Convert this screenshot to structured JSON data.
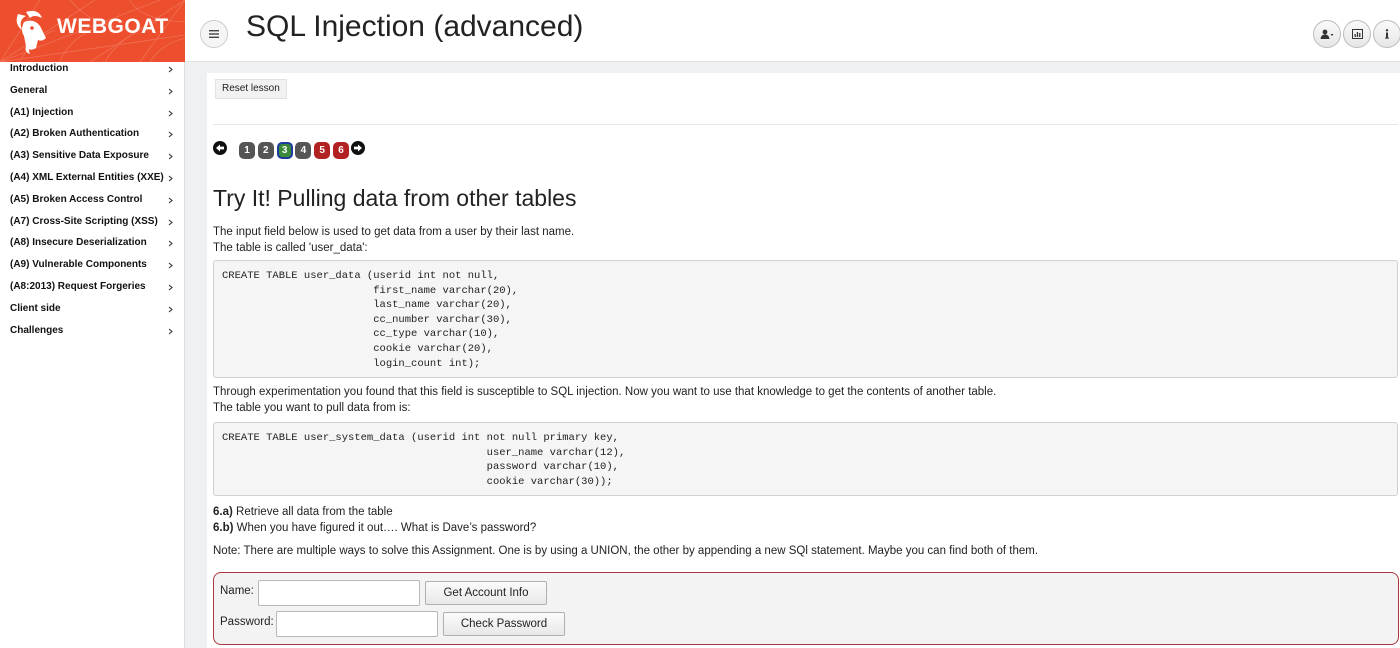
{
  "app": {
    "logo_text": "WEBGOAT",
    "page_title": "SQL Injection (advanced)"
  },
  "header_buttons": [
    {
      "icon": "user-icon"
    },
    {
      "icon": "chart-icon"
    },
    {
      "icon": "info-icon"
    }
  ],
  "sidebar": {
    "items": [
      {
        "label": "Introduction"
      },
      {
        "label": "General"
      },
      {
        "label": "(A1) Injection"
      },
      {
        "label": "(A2) Broken Authentication"
      },
      {
        "label": "(A3) Sensitive Data Exposure"
      },
      {
        "label": "(A4) XML External Entities (XXE)"
      },
      {
        "label": "(A5) Broken Access Control"
      },
      {
        "label": "(A7) Cross-Site Scripting (XSS)"
      },
      {
        "label": "(A8) Insecure Deserialization"
      },
      {
        "label": "(A9) Vulnerable Components"
      },
      {
        "label": "(A8:2013) Request Forgeries"
      },
      {
        "label": "Client side"
      },
      {
        "label": "Challenges"
      }
    ]
  },
  "lesson": {
    "reset_label": "Reset lesson",
    "pages": [
      {
        "num": "1",
        "status": "gray"
      },
      {
        "num": "2",
        "status": "gray"
      },
      {
        "num": "3",
        "status": "current"
      },
      {
        "num": "4",
        "status": "gray"
      },
      {
        "num": "5",
        "status": "red"
      },
      {
        "num": "6",
        "status": "red"
      }
    ],
    "heading": "Try It! Pulling data from other tables",
    "intro_line1": "The input field below is used to get data from a user by their last name.",
    "intro_line2": "The table is called 'user_data':",
    "code1": "CREATE TABLE user_data (userid int not null,\n                        first_name varchar(20),\n                        last_name varchar(20),\n                        cc_number varchar(30),\n                        cc_type varchar(10),\n                        cookie varchar(20),\n                        login_count int);",
    "para2_line1": "Through experimentation you found that this field is susceptible to SQL injection. Now you want to use that knowledge to get the contents of another table.",
    "para2_line2": "The table you want to pull data from is:",
    "code2": "CREATE TABLE user_system_data (userid int not null primary key,\n                                          user_name varchar(12),\n                                          password varchar(10),\n                                          cookie varchar(30));",
    "task_a_label": "6.a)",
    "task_a_text": " Retrieve all data from the table",
    "task_b_label": "6.b)",
    "task_b_text": " When you have figured it out…. What is Dave’s password?",
    "note": "Note: There are multiple ways to solve this Assignment. One is by using a UNION, the other by appending a new SQl statement. Maybe you can find both of them."
  },
  "form": {
    "name_label": "Name:",
    "name_value": "",
    "get_account_label": "Get Account Info",
    "password_label": "Password:",
    "password_value": "",
    "check_password_label": "Check Password"
  },
  "colors": {
    "brand": "#ec4e2e",
    "form_border": "#a9383e",
    "pill_gray": "#555555",
    "pill_green": "#3a8a3a",
    "pill_red": "#b22222"
  }
}
